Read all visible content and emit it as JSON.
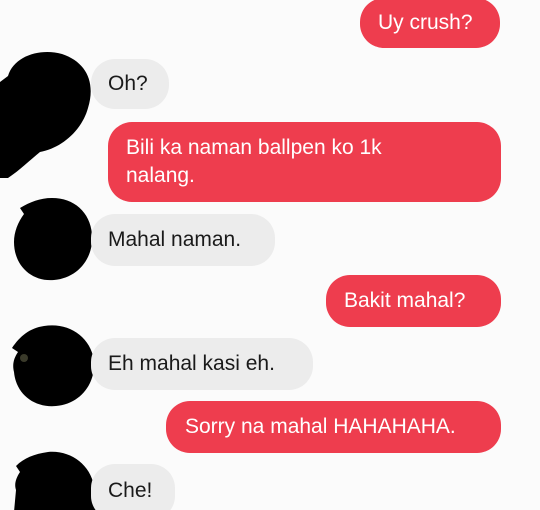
{
  "colors": {
    "outgoing_bubble": "#ee3d4e",
    "incoming_bubble": "#ececec",
    "background": "#fbfbfb",
    "redaction": "#000000"
  },
  "messages": [
    {
      "direction": "outgoing",
      "text": "Uy crush?"
    },
    {
      "direction": "incoming",
      "text": "Oh?"
    },
    {
      "direction": "outgoing",
      "line1": "Bili ka naman ballpen ko 1k",
      "line2": "nalang."
    },
    {
      "direction": "incoming",
      "text": "Mahal naman."
    },
    {
      "direction": "outgoing",
      "text": "Bakit mahal?"
    },
    {
      "direction": "incoming",
      "text": "Eh mahal kasi eh."
    },
    {
      "direction": "outgoing",
      "text": "Sorry na mahal HAHAHAHA."
    },
    {
      "direction": "incoming",
      "text": "Che!"
    }
  ],
  "avatars": [
    "redacted-avatar",
    "redacted-avatar",
    "redacted-avatar",
    "redacted-avatar"
  ]
}
